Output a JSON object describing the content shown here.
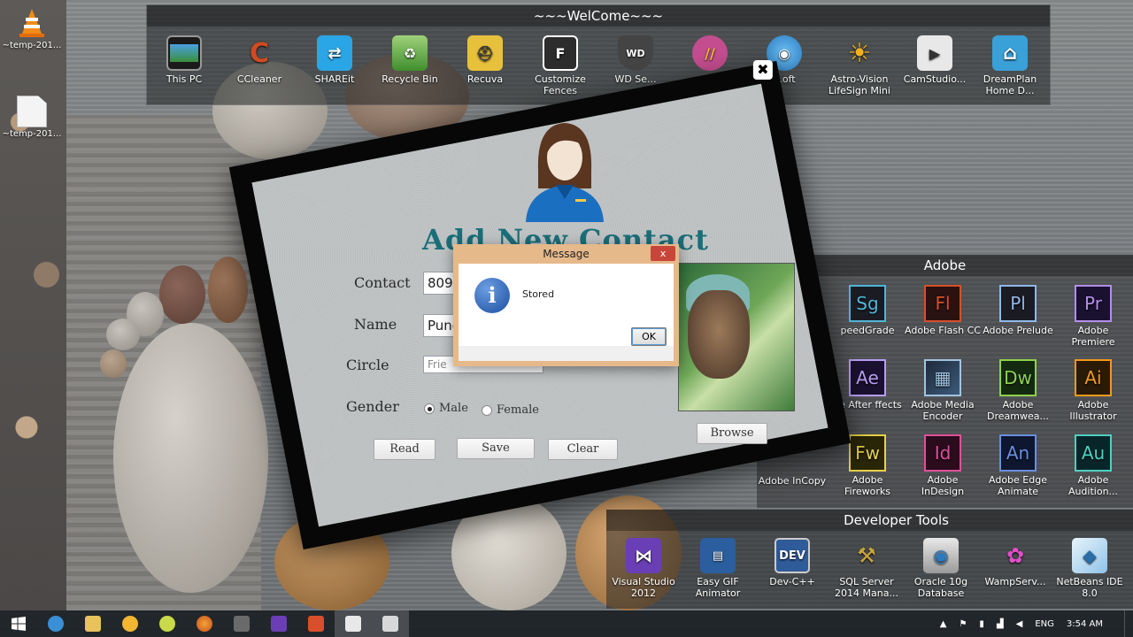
{
  "desktop": {
    "left_icons": [
      {
        "label": "~temp-201...",
        "icon": "vlc-cone-icon"
      },
      {
        "label": "~temp-201...",
        "icon": "document-icon"
      }
    ]
  },
  "fence_top": {
    "title": "~~~WelCome~~~",
    "icons": [
      {
        "label": "This PC",
        "icon": "monitor-icon",
        "color": "#3a8f3a"
      },
      {
        "label": "CCleaner",
        "icon": "ccleaner-icon",
        "color": "#d04a22"
      },
      {
        "label": "SHAREit",
        "icon": "shareit-icon",
        "color": "#2aa6e6"
      },
      {
        "label": "Recycle Bin",
        "icon": "recycle-bin-icon",
        "color": "#5fb84a"
      },
      {
        "label": "Recuva",
        "icon": "recuva-icon",
        "color": "#e7c13c"
      },
      {
        "label": "Customize Fences",
        "icon": "fences-icon",
        "color": "#2c2c2c"
      },
      {
        "label": "WD Se...",
        "icon": "wd-shield-icon",
        "color": "#444"
      },
      {
        "label": "",
        "icon": "pink-app-icon",
        "color": "#c44d8f"
      },
      {
        "label": "...oft",
        "icon": "globe-app-icon",
        "color": "#2a7ac0"
      },
      {
        "label": "Astro-Vision LifeSign Mini",
        "icon": "sun-icon",
        "color": "#f0b020"
      },
      {
        "label": "CamStudio...",
        "icon": "camera-icon",
        "color": "#ddd"
      },
      {
        "label": "DreamPlan Home D...",
        "icon": "house-icon",
        "color": "#3aa0d8"
      }
    ]
  },
  "fence_adobe": {
    "title": "Adobe",
    "apps": [
      {
        "abbr": "Sg",
        "label": "Adobe SpeedGrade",
        "display_label": "peedGrade",
        "color": "#4fb6d6"
      },
      {
        "abbr": "Fl",
        "label": "Adobe Flash CC",
        "color": "#d94f2b"
      },
      {
        "abbr": "Pl",
        "label": "Adobe Prelude",
        "color": "#8fb8e8"
      },
      {
        "abbr": "Pr",
        "label": "Adobe Premiere",
        "color": "#b38ee8"
      },
      {
        "abbr": "Ae",
        "label": "Adobe After Effects",
        "display_label": "be After ffects",
        "color": "#b79ef0"
      },
      {
        "abbr": "",
        "label": "Adobe Media Encoder",
        "color": "#a0c4e0"
      },
      {
        "abbr": "Dw",
        "label": "Adobe Dreamwea...",
        "color": "#8fd14f"
      },
      {
        "abbr": "Ai",
        "label": "Adobe Illustrator",
        "color": "#f29a1c"
      },
      {
        "abbr": "Fw",
        "label": "Adobe Fireworks",
        "color": "#e8d24a"
      },
      {
        "abbr": "Id",
        "label": "Adobe InDesign",
        "color": "#e04f9a"
      },
      {
        "abbr": "An",
        "label": "Adobe Edge Animate",
        "color": "#6a8fe0"
      },
      {
        "abbr": "Au",
        "label": "Adobe Audition...",
        "color": "#4fd0c0"
      }
    ],
    "extra_left": [
      {
        "label": "Adobe InCopy"
      }
    ]
  },
  "fence_dev": {
    "title": "Developer Tools",
    "apps": [
      {
        "label": "Visual Studio 2012",
        "icon": "visual-studio-icon",
        "color": "#6a3fb5"
      },
      {
        "label": "Easy GIF Animator",
        "icon": "film-icon",
        "color": "#2b5e9e"
      },
      {
        "label": "Dev-C++",
        "icon": "dev-cpp-icon",
        "color": "#2f5b9a"
      },
      {
        "label": "SQL Server 2014 Mana...",
        "icon": "tools-icon",
        "color": "#c8a43a"
      },
      {
        "label": "Oracle 10g Database",
        "icon": "database-icon",
        "color": "#cfcfcf"
      },
      {
        "label": "WampServ...",
        "icon": "wamp-icon",
        "color": "#e04fc8"
      },
      {
        "label": "NetBeans IDE 8.0",
        "icon": "netbeans-cube-icon",
        "color": "#bcdcf2"
      }
    ]
  },
  "app": {
    "close_symbol": "✖",
    "heading": "Add New Contact",
    "labels": {
      "contact": "Contact",
      "name": "Name",
      "circle": "Circle",
      "gender": "Gender"
    },
    "values": {
      "contact": "809",
      "name": "Pune",
      "circle": "Frie"
    },
    "gender_options": [
      {
        "label": "Male",
        "selected": true
      },
      {
        "label": "Female",
        "selected": false
      }
    ],
    "buttons": {
      "read": "Read",
      "save": "Save",
      "clear": "Clear",
      "browse": "Browse"
    }
  },
  "dialog": {
    "title": "Message",
    "close_symbol": "x",
    "icon": "i",
    "text": "Stored",
    "ok": "OK"
  },
  "taskbar": {
    "tray": {
      "language": "ENG",
      "time": "3:54 AM",
      "up_arrow": "▲"
    }
  }
}
